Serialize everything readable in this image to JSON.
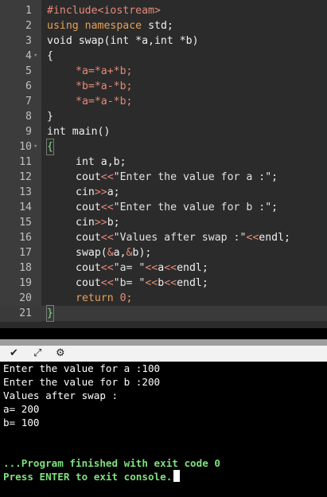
{
  "editor": {
    "lines": [
      {
        "n": "1"
      },
      {
        "n": "2"
      },
      {
        "n": "3"
      },
      {
        "n": "4",
        "fold": "▾"
      },
      {
        "n": "5"
      },
      {
        "n": "6"
      },
      {
        "n": "7"
      },
      {
        "n": "8"
      },
      {
        "n": "9"
      },
      {
        "n": "10",
        "fold": "▾"
      },
      {
        "n": "11"
      },
      {
        "n": "12"
      },
      {
        "n": "13"
      },
      {
        "n": "14"
      },
      {
        "n": "15"
      },
      {
        "n": "16"
      },
      {
        "n": "17"
      },
      {
        "n": "18"
      },
      {
        "n": "19"
      },
      {
        "n": "20"
      },
      {
        "n": "21"
      }
    ],
    "code": {
      "l1_pp": "#include",
      "l1_lt": "<iostream>",
      "l2_kw1": "using",
      "l2_kw2": "namespace",
      "l2_rest": " std;",
      "l3": "void swap(int *a,int *b)",
      "l4": "{",
      "l5": "*a=*a+*b;",
      "l6": "*b=*a-*b;",
      "l7": "*a=*a-*b;",
      "l8": "}",
      "l9": "int main()",
      "l10": "{",
      "l11": "int a,b;",
      "l12_a": "cout",
      "l12_op": "<<",
      "l12_s": "\"Enter the value for a :\"",
      "l12_e": ";",
      "l13_a": "cin",
      "l13_op": ">>",
      "l13_e": "a;",
      "l14_a": "cout",
      "l14_op": "<<",
      "l14_s": "\"Enter the value for b :\"",
      "l14_e": ";",
      "l15_a": "cin",
      "l15_op": ">>",
      "l15_e": "b;",
      "l16_a": "cout",
      "l16_op": "<<",
      "l16_s": "\"Values after swap :\"",
      "l16_op2": "<<",
      "l16_e": "endl;",
      "l17_a": "swap(",
      "l17_r1": "&",
      "l17_b": "a,",
      "l17_r2": "&",
      "l17_c": "b);",
      "l18_a": "cout",
      "l18_op": "<<",
      "l18_s": "\"a= \"",
      "l18_op2": "<<",
      "l18_b": "a",
      "l18_op3": "<<",
      "l18_e": "endl;",
      "l19_a": "cout",
      "l19_op": "<<",
      "l19_s": "\"b= \"",
      "l19_op2": "<<",
      "l19_b": "b",
      "l19_op3": "<<",
      "l19_e": "endl;",
      "l20_kw": "return",
      "l20_num": "0",
      "l20_e": ";",
      "l21": "}"
    }
  },
  "toolbar": {
    "icons": [
      "chevron-down-icon",
      "expand-icon",
      "debug-icon"
    ],
    "glyphs": [
      "✔",
      "⤢",
      "⚙"
    ]
  },
  "console": {
    "lines": [
      "Enter the value for a :100",
      "Enter the value for b :200",
      "Values after swap :",
      "a= 200",
      "b= 100",
      "",
      "",
      "...Program finished with exit code 0",
      "Press ENTER to exit console."
    ]
  }
}
